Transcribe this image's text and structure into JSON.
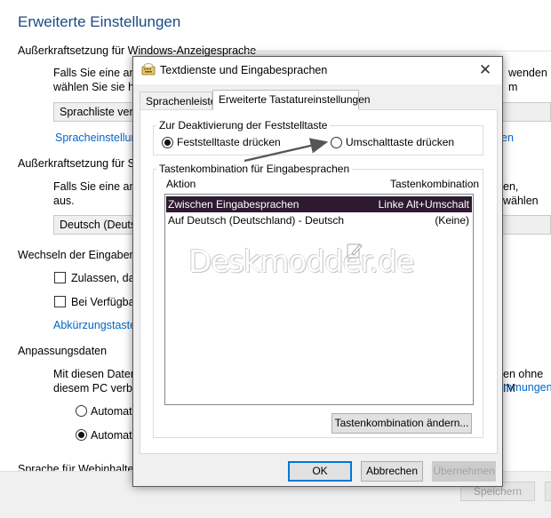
{
  "background": {
    "page_title": "Erweiterte Einstellungen",
    "sections": {
      "override_display_language": {
        "heading": "Außerkraftsetzung für Windows-Anzeigesprache",
        "text_line1": "Falls Sie eine and",
        "text_line1_right": "wenden m",
        "text_line2": "wählen Sie sie hie",
        "dropdown": "Sprachliste verw",
        "link": "Spracheinstellun",
        "link_right": "en"
      },
      "override_default_input": {
        "heading": "Außerkraftsetzung für St",
        "text_line1": "Falls Sie eine and",
        "text_line1_right": "en, wählen",
        "text_line2": "aus.",
        "dropdown": "Deutsch (Deuts"
      },
      "switching_input": {
        "heading": "Wechseln der Eingabeme",
        "checkbox1": "Zulassen, dass",
        "checkbox2": "Bei Verfügbark",
        "link": "Abkürzungstaste"
      },
      "personalization": {
        "heading": "Anpassungsdaten",
        "text_line1": "Mit diesen Daten",
        "text_line1_right": "en ohne IM",
        "text_line2": "diesem PC verbe",
        "link_right": "mmungen",
        "radio1": "Automat",
        "radio2": "Automat"
      },
      "web_content": {
        "heading": "Sprache für Webinhalte"
      }
    },
    "footer": {
      "save_button": "Speichern"
    }
  },
  "dialog": {
    "title": "Textdienste und Eingabesprachen",
    "close_glyph": "✕",
    "tabs": [
      {
        "label": "Sprachenleiste"
      },
      {
        "label": "Erweiterte Tastatureinstellungen"
      }
    ],
    "active_tab": "Erweiterte Tastatureinstellungen",
    "caps_lock_group": {
      "legend": "Zur Deaktivierung der Feststelltaste",
      "option_caps": "Feststelltaste drücken",
      "option_shift": "Umschalttaste drücken",
      "selected": "Feststelltaste drücken"
    },
    "hotkeys_group": {
      "legend": "Tastenkombination für Eingabesprachen",
      "columns": {
        "action": "Aktion",
        "hotkey": "Tastenkombination"
      },
      "rows": [
        {
          "action": "Zwischen Eingabesprachen",
          "hotkey": "Linke Alt+Umschalt",
          "selected": true
        },
        {
          "action": "Auf Deutsch (Deutschland) - Deutsch",
          "hotkey": "(Keine)",
          "selected": false
        }
      ],
      "change_button": "Tastenkombination ändern..."
    },
    "buttons": {
      "ok": "OK",
      "cancel": "Abbrechen",
      "apply": "Übernehmen"
    }
  },
  "watermark": {
    "text": "Deskmodder.de"
  },
  "colors": {
    "title_blue": "#1a4a86",
    "link_blue": "#0066cc",
    "selection": "#2e1a30",
    "default_button_border": "#0078d7",
    "arrow": "#555555"
  }
}
